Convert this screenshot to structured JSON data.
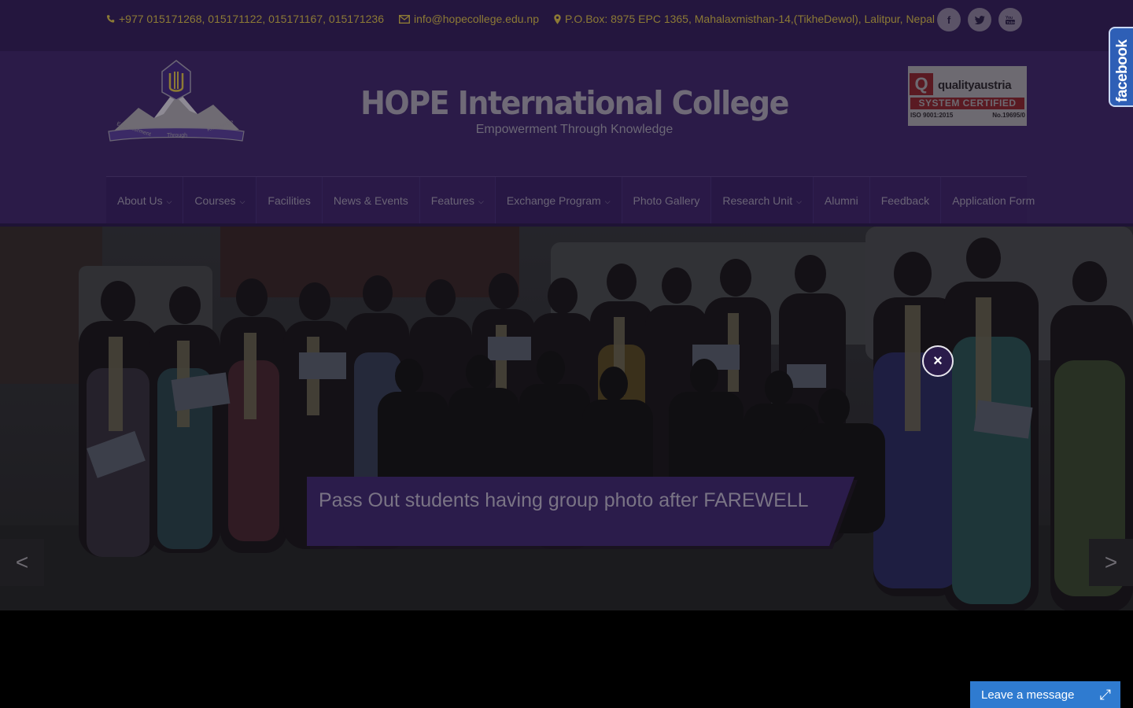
{
  "topbar": {
    "phone": "+977 015171268, 015171122, 015171167, 015171236",
    "email": "info@hopecollege.edu.np",
    "address": "P.O.Box: 8975 EPC 1365, Mahalaxmisthan-14,(TikheDewol), Lalitpur, Nepal",
    "socials": [
      {
        "icon": "facebook-icon",
        "glyph": "f"
      },
      {
        "icon": "twitter-icon",
        "glyph": "t"
      },
      {
        "icon": "youtube-icon",
        "glyph": "▶"
      }
    ]
  },
  "header": {
    "logo_text": [
      "Empowerment",
      "Through",
      "Knowledge"
    ],
    "college_name": "HOPE International College",
    "tagline": "Empowerment Through Knowledge",
    "certification": {
      "brand": "qualityaustria",
      "mark": "Q",
      "status": "SYSTEM CERTIFIED",
      "standard": "ISO 9001:2015",
      "number": "No.19695/0"
    }
  },
  "nav": {
    "items": [
      {
        "label": "About Us",
        "dropdown": true
      },
      {
        "label": "Courses",
        "dropdown": true
      },
      {
        "label": "Facilities",
        "dropdown": false
      },
      {
        "label": "News & Events",
        "dropdown": false
      },
      {
        "label": "Features",
        "dropdown": true
      },
      {
        "label": "Exchange Program",
        "dropdown": true
      },
      {
        "label": "Photo Gallery",
        "dropdown": false
      },
      {
        "label": "Research Unit",
        "dropdown": true
      },
      {
        "label": "Alumni",
        "dropdown": false
      },
      {
        "label": "Feedback",
        "dropdown": false
      },
      {
        "label": "Application Form",
        "dropdown": false
      }
    ]
  },
  "slider": {
    "caption": "Pass Out students having group photo after FAREWELL",
    "prev_label": "<",
    "next_label": ">"
  },
  "overlay": {
    "close_label": "×"
  },
  "facebook_tab": {
    "label": "facebook"
  },
  "chat": {
    "label": "Leave a message",
    "maximize_glyph": "⤢"
  },
  "colors": {
    "topbar_bg": "#24163e",
    "header_bg": "#2b1b48",
    "accent_text": "#8c7a35",
    "facebook_blue": "#2e5fb6",
    "chat_blue": "#2f7bd0"
  }
}
